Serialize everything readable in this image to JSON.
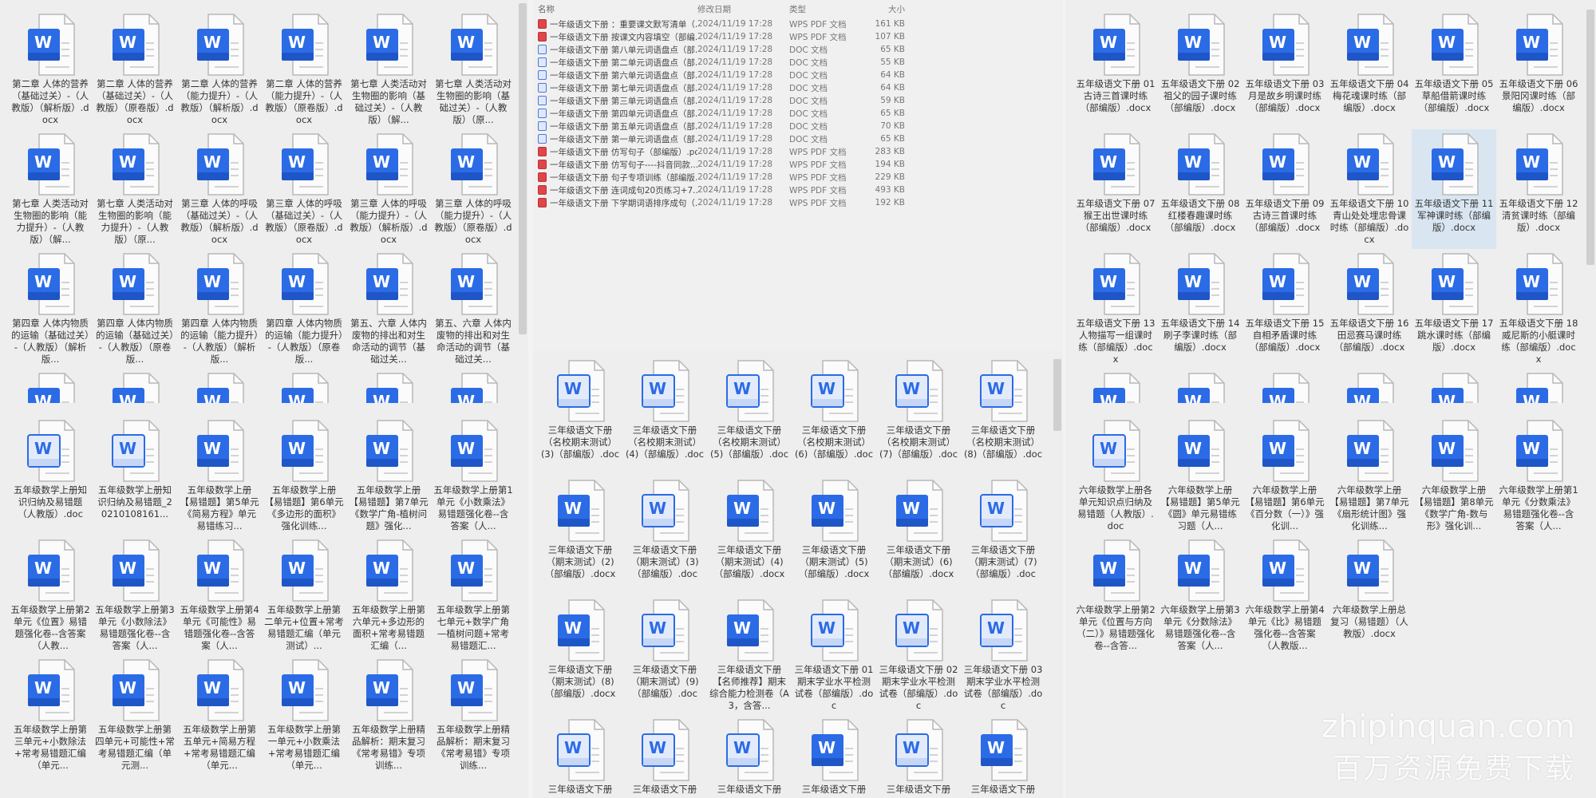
{
  "colors": {
    "word_blue": "#2b6be6",
    "word_blue_dark": "#1e56c8",
    "word_light": "#e3ebfb",
    "selection": "#d9e6f2"
  },
  "panels": {
    "p1": {
      "clipped_icons": 6,
      "items": [
        {
          "label": "第二章 人体的营养（基础过关）-（人教版）（解析版）.docx",
          "variant": "solid"
        },
        {
          "label": "第二章 人体的营养（基础过关）-（人教版）（原卷版）.docx",
          "variant": "solid"
        },
        {
          "label": "第二章 人体的营养（能力提升）-（人教版）（解析版）.docx",
          "variant": "solid"
        },
        {
          "label": "第二章 人体的营养（能力提升）-（人教版）（原卷版）.docx",
          "variant": "solid"
        },
        {
          "label": "第七章 人类活动对生物圈的影响（基础过关）-（人教版）（解...",
          "variant": "solid"
        },
        {
          "label": "第七章 人类活动对生物圈的影响（基础过关）-（人教版）（原...",
          "variant": "solid"
        },
        {
          "label": "第七章 人类活动对生物圈的影响（能力提升）-（人教版）（解...",
          "variant": "solid"
        },
        {
          "label": "第七章 人类活动对生物圈的影响（能力提升）-（人教版）（原...",
          "variant": "solid"
        },
        {
          "label": "第三章 人体的呼吸（基础过关）-（人教版）（解析版）.docx",
          "variant": "solid"
        },
        {
          "label": "第三章 人体的呼吸（基础过关）-（人教版）（原卷版）.docx",
          "variant": "solid"
        },
        {
          "label": "第三章 人体的呼吸（能力提升）-（人教版）（解析版）.docx",
          "variant": "solid"
        },
        {
          "label": "第三章 人体的呼吸（能力提升）-（人教版）（原卷版）.docx",
          "variant": "solid"
        },
        {
          "label": "第四章 人体内物质的运输（基础过关）-（人教版）（解析版...",
          "variant": "solid"
        },
        {
          "label": "第四章 人体内物质的运输（基础过关）-（人教版）（原卷版...",
          "variant": "solid"
        },
        {
          "label": "第四章 人体内物质的运输（能力提升）-（人教版）（解析版...",
          "variant": "solid"
        },
        {
          "label": "第四章 人体内物质的运输（能力提升）-（人教版）（原卷版...",
          "variant": "solid"
        },
        {
          "label": "第五、六章 人体内废物的排出和对生命活动的调节（基础过关...",
          "variant": "solid"
        },
        {
          "label": "第五、六章 人体内废物的排出和对生命活动的调节（基础过关...",
          "variant": "solid"
        }
      ]
    },
    "p2": {
      "items": [
        {
          "label": "五年级数学上册知识归纳及易错题（人教版）.doc",
          "variant": "light"
        },
        {
          "label": "五年级数学上册知识归纳及易错题_20210108161...",
          "variant": "light"
        },
        {
          "label": "五年级数学上册【易错题】第5单元《简易方程》单元易错练习...",
          "variant": "solid"
        },
        {
          "label": "五年级数学上册【易错题】第6单元《多边形的面积》强化训练...",
          "variant": "solid"
        },
        {
          "label": "五年级数学上册【易错题】第7单元《数学广角-植树问题》强化...",
          "variant": "solid"
        },
        {
          "label": "五年级数学上册第1单元《小数乘法》易错题强化卷--含答案（人...",
          "variant": "solid"
        },
        {
          "label": "五年级数学上册第2单元《位置》易错题强化卷--含答案（人教...",
          "variant": "solid"
        },
        {
          "label": "五年级数学上册第3单元《小数除法》易错题强化卷--含答案（人...",
          "variant": "solid"
        },
        {
          "label": "五年级数学上册第4单元《可能性》易错题强化卷--含答案（人...",
          "variant": "solid"
        },
        {
          "label": "五年级数学上册第二单元+位置+常考易错题汇编（单元测试）...",
          "variant": "solid"
        },
        {
          "label": "五年级数学上册第六单元+多边形的面积+常考易错题汇编（...",
          "variant": "solid"
        },
        {
          "label": "五年级数学上册第七单元+数学广角—植树问题+常考易错题汇...",
          "variant": "solid"
        },
        {
          "label": "五年级数学上册第三单元+小数除法+常考易错题汇编（单元...",
          "variant": "solid"
        },
        {
          "label": "五年级数学上册第四单元+可能性+常考易错题汇编（单元测...",
          "variant": "solid"
        },
        {
          "label": "五年级数学上册第五单元+简易方程+常考易错题汇编（单元...",
          "variant": "solid"
        },
        {
          "label": "五年级数学上册第一单元+小数乘法+常考易错题汇编（单元...",
          "variant": "solid"
        },
        {
          "label": "五年级数学上册精品解析：期末复习《常考易错》专项训练...",
          "variant": "solid"
        },
        {
          "label": "五年级数学上册精品解析：期末复习《常考易错》专项训练...",
          "variant": "solid"
        }
      ]
    },
    "p4": {
      "items": [
        {
          "label": "三年级语文下册（名校期末测试）(3)（部编版）.doc",
          "variant": "light"
        },
        {
          "label": "三年级语文下册（名校期末测试）(4)（部编版）.doc",
          "variant": "light"
        },
        {
          "label": "三年级语文下册（名校期末测试）(5)（部编版）.doc",
          "variant": "light"
        },
        {
          "label": "三年级语文下册（名校期末测试）(6)（部编版）.doc",
          "variant": "light"
        },
        {
          "label": "三年级语文下册（名校期末测试）(7)（部编版）.doc",
          "variant": "light"
        },
        {
          "label": "三年级语文下册（名校期末测试）(8)（部编版）.doc",
          "variant": "light"
        },
        {
          "label": "三年级语文下册（期末测试）(2)（部编版）.docx",
          "variant": "solid"
        },
        {
          "label": "三年级语文下册（期末测试）(3)（部编版）.doc",
          "variant": "light"
        },
        {
          "label": "三年级语文下册（期末测试）(4)（部编版）.docx",
          "variant": "solid"
        },
        {
          "label": "三年级语文下册（期末测试）(5)（部编版）.docx",
          "variant": "solid"
        },
        {
          "label": "三年级语文下册（期末测试）(6)（部编版）.docx",
          "variant": "solid"
        },
        {
          "label": "三年级语文下册（期末测试）(7)（部编版）.doc",
          "variant": "light"
        },
        {
          "label": "三年级语文下册（期末测试）(8)（部编版）.docx",
          "variant": "solid"
        },
        {
          "label": "三年级语文下册（期末测试）(9)（部编版）.doc",
          "variant": "light"
        },
        {
          "label": "三年级语文下册【名师推荐】期末综合能力检测卷（A3，含答...",
          "variant": "solid"
        },
        {
          "label": "三年级语文下册 01 期末学业水平检测试卷（部编版）.doc",
          "variant": "light"
        },
        {
          "label": "三年级语文下册 02 期末学业水平检测试卷（部编版）.doc",
          "variant": "light"
        },
        {
          "label": "三年级语文下册 03 期末学业水平检测试卷（部编版）.doc",
          "variant": "light"
        },
        {
          "label": "三年级语文下册",
          "variant": "light"
        },
        {
          "label": "三年级语文下册",
          "variant": "light"
        },
        {
          "label": "三年级语文下册",
          "variant": "light"
        },
        {
          "label": "三年级语文下册",
          "variant": "solid"
        },
        {
          "label": "三年级语文下册",
          "variant": "light"
        },
        {
          "label": "三年级语文下册",
          "variant": "solid"
        }
      ]
    },
    "p5": {
      "clipped_icons": 6,
      "items": [
        {
          "label": "五年级语文下册 01 古诗三首课时练（部编版）.docx",
          "variant": "solid"
        },
        {
          "label": "五年级语文下册 02 祖父的园子课时练（部编版）.docx",
          "variant": "solid"
        },
        {
          "label": "五年级语文下册 03 月是故乡明课时练（部编版）.docx",
          "variant": "solid"
        },
        {
          "label": "五年级语文下册 04 梅花魂课时练（部编版）.docx",
          "variant": "solid"
        },
        {
          "label": "五年级语文下册 05 草船借箭课时练（部编版）.docx",
          "variant": "solid"
        },
        {
          "label": "五年级语文下册 06 景阳冈课时练（部编版）.docx",
          "variant": "solid"
        },
        {
          "label": "五年级语文下册 07 猴王出世课时练（部编版）.docx",
          "variant": "solid"
        },
        {
          "label": "五年级语文下册 08 红楼春趣课时练（部编版）.docx",
          "variant": "solid"
        },
        {
          "label": "五年级语文下册 09 古诗三首课时练（部编版）.docx",
          "variant": "solid"
        },
        {
          "label": "五年级语文下册 10 青山处处埋忠骨课时练（部编版）.docx",
          "variant": "solid"
        },
        {
          "label": "五年级语文下册 11 军神课时练（部编版）.docx",
          "variant": "solid",
          "selected": true
        },
        {
          "label": "五年级语文下册 12 清贫课时练（部编版）.docx",
          "variant": "solid"
        },
        {
          "label": "五年级语文下册 13 人物描写一组课时练（部编版）.docx",
          "variant": "solid"
        },
        {
          "label": "五年级语文下册 14 刷子李课时练（部编版）.docx",
          "variant": "solid"
        },
        {
          "label": "五年级语文下册 15 自相矛盾课时练（部编版）.docx",
          "variant": "solid"
        },
        {
          "label": "五年级语文下册 16 田忌赛马课时练（部编版）.docx",
          "variant": "solid"
        },
        {
          "label": "五年级语文下册 17 跳水课时练（部编版）.docx",
          "variant": "solid"
        },
        {
          "label": "五年级语文下册 18 威尼斯的小艇课时练（部编版）.docx",
          "variant": "solid"
        }
      ]
    },
    "p6": {
      "items": [
        {
          "label": "六年级数学上册各单元知识点归纳及易错题（人教版）.doc",
          "variant": "light"
        },
        {
          "label": "六年级数学上册【易错题】第5单元《圆》单元易错练习题（人...",
          "variant": "solid"
        },
        {
          "label": "六年级数学上册【易错题】第6单元《百分数（一）》强化训...",
          "variant": "solid"
        },
        {
          "label": "六年级数学上册【易错题】第7单元《扇形统计图》强化训练...",
          "variant": "solid"
        },
        {
          "label": "六年级数学上册【易错题】第8单元《数学广角-数与形》强化训...",
          "variant": "solid"
        },
        {
          "label": "六年级数学上册第1单元《分数乘法》易错题强化卷--含答案（人...",
          "variant": "solid"
        },
        {
          "label": "六年级数学上册第2单元《位置与方向（二）》易错题强化卷--含答...",
          "variant": "solid"
        },
        {
          "label": "六年级数学上册第3单元《分数除法》易错题强化卷--含答案（人...",
          "variant": "solid"
        },
        {
          "label": "六年级数学上册第4单元《比》易错题强化卷--含答案（人教版...",
          "variant": "solid"
        },
        {
          "label": "六年级数学上册总复习（易错题）（人教版）.docx",
          "variant": "solid"
        }
      ]
    }
  },
  "list": {
    "headers": {
      "name": "名称",
      "date": "修改日期",
      "type": "类型",
      "size": "大小"
    },
    "rows": [
      {
        "name": "一年级语文下册 ：重要课文默写清单（...",
        "date": "2024/11/19 17:28",
        "type": "WPS PDF 文档",
        "size": "161 KB",
        "icon": "pdf"
      },
      {
        "name": "一年级语文下册 按课文内容填空（部编...",
        "date": "2024/11/19 17:28",
        "type": "WPS PDF 文档",
        "size": "107 KB",
        "icon": "pdf"
      },
      {
        "name": "一年级语文下册 第八单元词语盘点（部...",
        "date": "2024/11/19 17:28",
        "type": "DOC 文档",
        "size": "65 KB",
        "icon": "doc"
      },
      {
        "name": "一年级语文下册 第二单元词语盘点（部...",
        "date": "2024/11/19 17:28",
        "type": "DOC 文档",
        "size": "55 KB",
        "icon": "doc"
      },
      {
        "name": "一年级语文下册 第六单元词语盘点（部...",
        "date": "2024/11/19 17:28",
        "type": "DOC 文档",
        "size": "64 KB",
        "icon": "doc"
      },
      {
        "name": "一年级语文下册 第七单元词语盘点（部...",
        "date": "2024/11/19 17:28",
        "type": "DOC 文档",
        "size": "64 KB",
        "icon": "doc"
      },
      {
        "name": "一年级语文下册 第三单元词语盘点（部...",
        "date": "2024/11/19 17:28",
        "type": "DOC 文档",
        "size": "59 KB",
        "icon": "doc"
      },
      {
        "name": "一年级语文下册 第四单元词语盘点（部...",
        "date": "2024/11/19 17:28",
        "type": "DOC 文档",
        "size": "65 KB",
        "icon": "doc"
      },
      {
        "name": "一年级语文下册 第五单元词语盘点（部...",
        "date": "2024/11/19 17:28",
        "type": "DOC 文档",
        "size": "70 KB",
        "icon": "doc"
      },
      {
        "name": "一年级语文下册 第一单元词语盘点（部...",
        "date": "2024/11/19 17:28",
        "type": "DOC 文档",
        "size": "65 KB",
        "icon": "doc"
      },
      {
        "name": "一年级语文下册 仿写句子（部编版）.pdf",
        "date": "2024/11/19 17:28",
        "type": "WPS PDF 文档",
        "size": "283 KB",
        "icon": "pdf"
      },
      {
        "name": "一年级语文下册 仿写句子----抖音同款...",
        "date": "2024/11/19 17:28",
        "type": "WPS PDF 文档",
        "size": "194 KB",
        "icon": "pdf"
      },
      {
        "name": "一年级语文下册 句子专项训练（部编版...",
        "date": "2024/11/19 17:28",
        "type": "WPS PDF 文档",
        "size": "229 KB",
        "icon": "pdf"
      },
      {
        "name": "一年级语文下册 连词成句20页练习+7...",
        "date": "2024/11/19 17:28",
        "type": "WPS PDF 文档",
        "size": "493 KB",
        "icon": "pdf"
      },
      {
        "name": "一年级语文下册 下学期词语排序成句（...",
        "date": "2024/11/19 17:28",
        "type": "WPS PDF 文档",
        "size": "192 KB",
        "icon": "pdf"
      }
    ]
  },
  "watermark": {
    "line1": "zhipinquan.com",
    "line2": "百万资源免费下载"
  }
}
